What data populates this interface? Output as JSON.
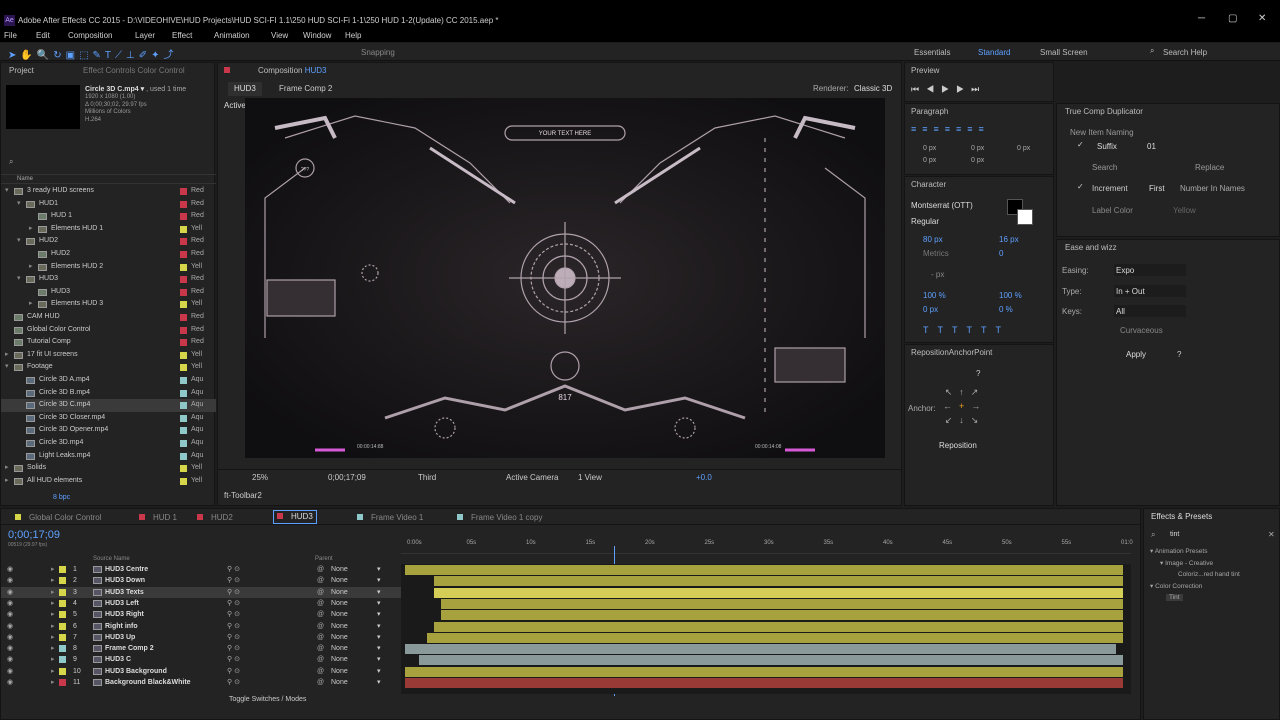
{
  "window": {
    "title": "Adobe After Effects CC 2015 - D:\\VIDEOHIVE\\HUD Projects\\HUD SCI-FI 1.1\\250 HUD SCI-Fi 1-1\\250 HUD 1-2(Update) CC 2015.aep *",
    "app_icon": "Ae"
  },
  "menu": [
    "File",
    "Edit",
    "Composition",
    "Layer",
    "Effect",
    "Animation",
    "View",
    "Window",
    "Help"
  ],
  "toolbar": {
    "snapping": "Snapping",
    "workspaces": [
      "Essentials",
      "Standard",
      "Small Screen"
    ],
    "search_help": "Search Help"
  },
  "project": {
    "tab": "Project",
    "effect_controls": "Effect Controls Color Control",
    "preview_name": "Circle 3D C.mp4",
    "preview_used": ", used 1 time",
    "preview_info": [
      "1920 x 1080 (1.00)",
      "Δ 0;00;30;02, 29.97 fps",
      "Millions of Colors",
      "H.264"
    ],
    "col_name": "Name",
    "bpc": "8 bpc",
    "items": [
      {
        "name": "3 ready HUD screens",
        "indent": 0,
        "type": "folder",
        "label": "Red",
        "color": "#c8384a",
        "open": true
      },
      {
        "name": "HUD1",
        "indent": 1,
        "type": "folder",
        "label": "Red",
        "color": "#c8384a",
        "open": true
      },
      {
        "name": "HUD 1",
        "indent": 2,
        "type": "comp",
        "label": "Red",
        "color": "#c8384a"
      },
      {
        "name": "Elements HUD 1",
        "indent": 2,
        "type": "folder",
        "label": "Yell",
        "color": "#d6d64a"
      },
      {
        "name": "HUD2",
        "indent": 1,
        "type": "folder",
        "label": "Red",
        "color": "#c8384a",
        "open": true
      },
      {
        "name": "HUD2",
        "indent": 2,
        "type": "comp",
        "label": "Red",
        "color": "#c8384a"
      },
      {
        "name": "Elements HUD 2",
        "indent": 2,
        "type": "folder",
        "label": "Yell",
        "color": "#d6d64a"
      },
      {
        "name": "HUD3",
        "indent": 1,
        "type": "folder",
        "label": "Red",
        "color": "#c8384a",
        "open": true
      },
      {
        "name": "HUD3",
        "indent": 2,
        "type": "comp",
        "label": "Red",
        "color": "#c8384a"
      },
      {
        "name": "Elements HUD 3",
        "indent": 2,
        "type": "folder",
        "label": "Yell",
        "color": "#d6d64a"
      },
      {
        "name": "CAM HUD",
        "indent": 0,
        "type": "comp",
        "label": "Red",
        "color": "#c8384a"
      },
      {
        "name": "Global Color Control",
        "indent": 0,
        "type": "comp",
        "label": "Red",
        "color": "#c8384a"
      },
      {
        "name": "Tutorial Comp",
        "indent": 0,
        "type": "comp",
        "label": "Red",
        "color": "#c8384a"
      },
      {
        "name": "17 fit UI screens",
        "indent": 0,
        "type": "folder",
        "label": "Yell",
        "color": "#d6d64a"
      },
      {
        "name": "Footage",
        "indent": 0,
        "type": "folder",
        "label": "Yell",
        "color": "#d6d64a",
        "open": true
      },
      {
        "name": "Circle 3D A.mp4",
        "indent": 1,
        "type": "footage",
        "label": "Aqu",
        "color": "#8ec8c8"
      },
      {
        "name": "Circle 3D B.mp4",
        "indent": 1,
        "type": "footage",
        "label": "Aqu",
        "color": "#8ec8c8"
      },
      {
        "name": "Circle 3D C.mp4",
        "indent": 1,
        "type": "footage",
        "label": "Aqu",
        "color": "#8ec8c8",
        "selected": true
      },
      {
        "name": "Circle 3D Closer.mp4",
        "indent": 1,
        "type": "footage",
        "label": "Aqu",
        "color": "#8ec8c8"
      },
      {
        "name": "Circle 3D Opener.mp4",
        "indent": 1,
        "type": "footage",
        "label": "Aqu",
        "color": "#8ec8c8"
      },
      {
        "name": "Circle 3D.mp4",
        "indent": 1,
        "type": "footage",
        "label": "Aqu",
        "color": "#8ec8c8"
      },
      {
        "name": "Light Leaks.mp4",
        "indent": 1,
        "type": "footage",
        "label": "Aqu",
        "color": "#8ec8c8"
      },
      {
        "name": "Solids",
        "indent": 0,
        "type": "folder",
        "label": "Yell",
        "color": "#d6d64a"
      },
      {
        "name": "All HUD elements",
        "indent": 0,
        "type": "folder",
        "label": "Yell",
        "color": "#d6d64a"
      }
    ]
  },
  "composition": {
    "tab": "Composition",
    "comp_name": "HUD3",
    "breadcrumb": [
      "HUD3",
      "Frame Comp 2"
    ],
    "renderer_label": "Renderer:",
    "renderer": "Classic 3D",
    "view_label": "Active Camera",
    "zoom": "25%",
    "timecode": "0;00;17;09",
    "resolution": "Third",
    "camera": "Active Camera",
    "views": "1 View",
    "exposure": "+0.0",
    "hud_text": {
      "your_text": "YOUR TEXT HERE",
      "tc_left": "00:00:14:88",
      "tc_right": "00:00:14:08",
      "center_num": "817",
      "badge": "???"
    }
  },
  "flowchart": "ft-Toolbar2",
  "preview": {
    "title": "Preview"
  },
  "paragraph": {
    "title": "Paragraph",
    "vals": [
      "0 px",
      "0 px",
      "0 px",
      "0 px",
      "0 px"
    ]
  },
  "character": {
    "title": "Character",
    "font": "Montserrat (OTT)",
    "style": "Regular",
    "size": "80 px",
    "leading": "16 px",
    "metrics": "Metrics",
    "tracking": "0",
    "line": "- px",
    "vscale": "100 %",
    "hscale": "100 %",
    "baseline": "0 px",
    "tsume": "0 %"
  },
  "anchor": {
    "title": "RepositionAnchorPoint",
    "label": "Anchor:",
    "button": "Reposition",
    "help": "?"
  },
  "true_comp": {
    "title": "True Comp Duplicator",
    "new_item": "New Item Naming",
    "suffix": "Suffix",
    "suffix_val": "01",
    "search": "Search",
    "replace": "Replace",
    "increment": "Increment",
    "first": "First",
    "number": "Number In Names",
    "label_color": "Label Color",
    "yellow": "Yellow"
  },
  "ease": {
    "title": "Ease and wizz",
    "easing_label": "Easing:",
    "easing": "Expo",
    "type_label": "Type:",
    "type": "In + Out",
    "keys_label": "Keys:",
    "keys": "All",
    "curvaceous": "Curvaceous",
    "apply": "Apply",
    "help": "?"
  },
  "effects": {
    "title": "Effects & Presets",
    "search": "tint",
    "tree": [
      "Animation Presets",
      "Image - Creative",
      "Coloriz...red hand tint",
      "Color Correction",
      "Tint"
    ]
  },
  "timeline": {
    "tabs": [
      "Global Color Control",
      "HUD 1",
      "HUD2",
      "HUD3",
      "Frame Video 1",
      "Frame Video 1 copy"
    ],
    "active_tab": "HUD3",
    "timecode": "0;00;17;09",
    "frames": "00519 (29.97 fps)",
    "col_source": "Source Name",
    "col_parent": "Parent",
    "toggle": "Toggle Switches / Modes",
    "ruler": [
      "0:00s",
      "05s",
      "10s",
      "15s",
      "20s",
      "25s",
      "30s",
      "35s",
      "40s",
      "45s",
      "50s",
      "55s",
      "01:0"
    ],
    "layers": [
      {
        "num": "1",
        "name": "HUD3 Centre",
        "parent": "None",
        "color": "#d6d64a",
        "start": 0.0,
        "end": 1.0,
        "bar": "#a7a13e"
      },
      {
        "num": "2",
        "name": "HUD3 Down",
        "parent": "None",
        "color": "#d6d64a",
        "start": 0.04,
        "end": 1.0,
        "bar": "#a7a13e"
      },
      {
        "num": "3",
        "name": "HUD3 Texts",
        "parent": "None",
        "color": "#d6d64a",
        "start": 0.04,
        "end": 1.0,
        "bar": "#d4ce57",
        "selected": true
      },
      {
        "num": "4",
        "name": "HUD3 Left",
        "parent": "None",
        "color": "#d6d64a",
        "start": 0.05,
        "end": 1.0,
        "bar": "#a7a13e"
      },
      {
        "num": "5",
        "name": "HUD3 Right",
        "parent": "None",
        "color": "#d6d64a",
        "start": 0.05,
        "end": 1.0,
        "bar": "#a7a13e"
      },
      {
        "num": "6",
        "name": "Right info",
        "parent": "None",
        "color": "#d6d64a",
        "start": 0.04,
        "end": 1.0,
        "bar": "#a7a13e"
      },
      {
        "num": "7",
        "name": "HUD3 Up",
        "parent": "None",
        "color": "#d6d64a",
        "start": 0.03,
        "end": 1.0,
        "bar": "#a7a13e"
      },
      {
        "num": "8",
        "name": "Frame Comp 2",
        "parent": "None",
        "color": "#8ec8c8",
        "start": 0.0,
        "end": 0.99,
        "bar": "#8a9a9a"
      },
      {
        "num": "9",
        "name": "HUD3 C",
        "parent": "None",
        "color": "#8ec8c8",
        "start": 0.02,
        "end": 1.0,
        "bar": "#8a9a9a"
      },
      {
        "num": "10",
        "name": "HUD3 Background",
        "parent": "None",
        "color": "#d6d64a",
        "start": 0.0,
        "end": 1.0,
        "bar": "#a7a13e"
      },
      {
        "num": "11",
        "name": "Background Black&White",
        "parent": "None",
        "color": "#c8384a",
        "start": 0.0,
        "end": 1.0,
        "bar": "#9a3a36"
      }
    ],
    "playhead": 0.29
  }
}
